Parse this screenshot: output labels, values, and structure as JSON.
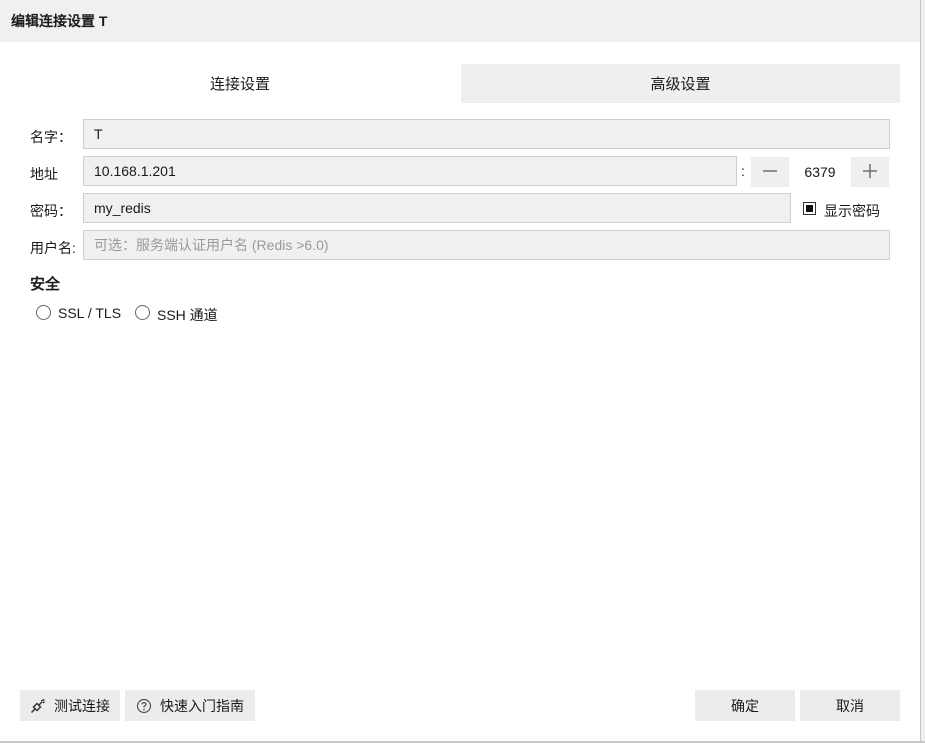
{
  "window": {
    "title": "编辑连接设置 T"
  },
  "tabs": [
    {
      "label": "连接设置",
      "active": true
    },
    {
      "label": "高级设置",
      "active": false
    }
  ],
  "form": {
    "name": {
      "label": "名字：",
      "value": "T"
    },
    "address": {
      "label": "地址",
      "value": "10.168.1.201",
      "separator": ":"
    },
    "port": {
      "value": "6379",
      "decrement_icon": "minus-icon",
      "increment_icon": "plus-icon"
    },
    "password": {
      "label": "密码：",
      "value": "my_redis",
      "show_password_label": "显示密码",
      "show_password_checked": true
    },
    "username": {
      "label": "用户名:",
      "placeholder": "可选：服务端认证用户名 (Redis >6.0)"
    }
  },
  "security": {
    "title": "安全",
    "options": [
      {
        "label": "SSL / TLS",
        "selected": false
      },
      {
        "label": "SSH 通道",
        "selected": false
      }
    ]
  },
  "footer": {
    "test_connection": {
      "label": "测试连接",
      "icon": "plug-icon"
    },
    "quick_start": {
      "label": "快速入门指南",
      "icon": "help-circle-icon"
    },
    "ok": "确定",
    "cancel": "取消"
  }
}
